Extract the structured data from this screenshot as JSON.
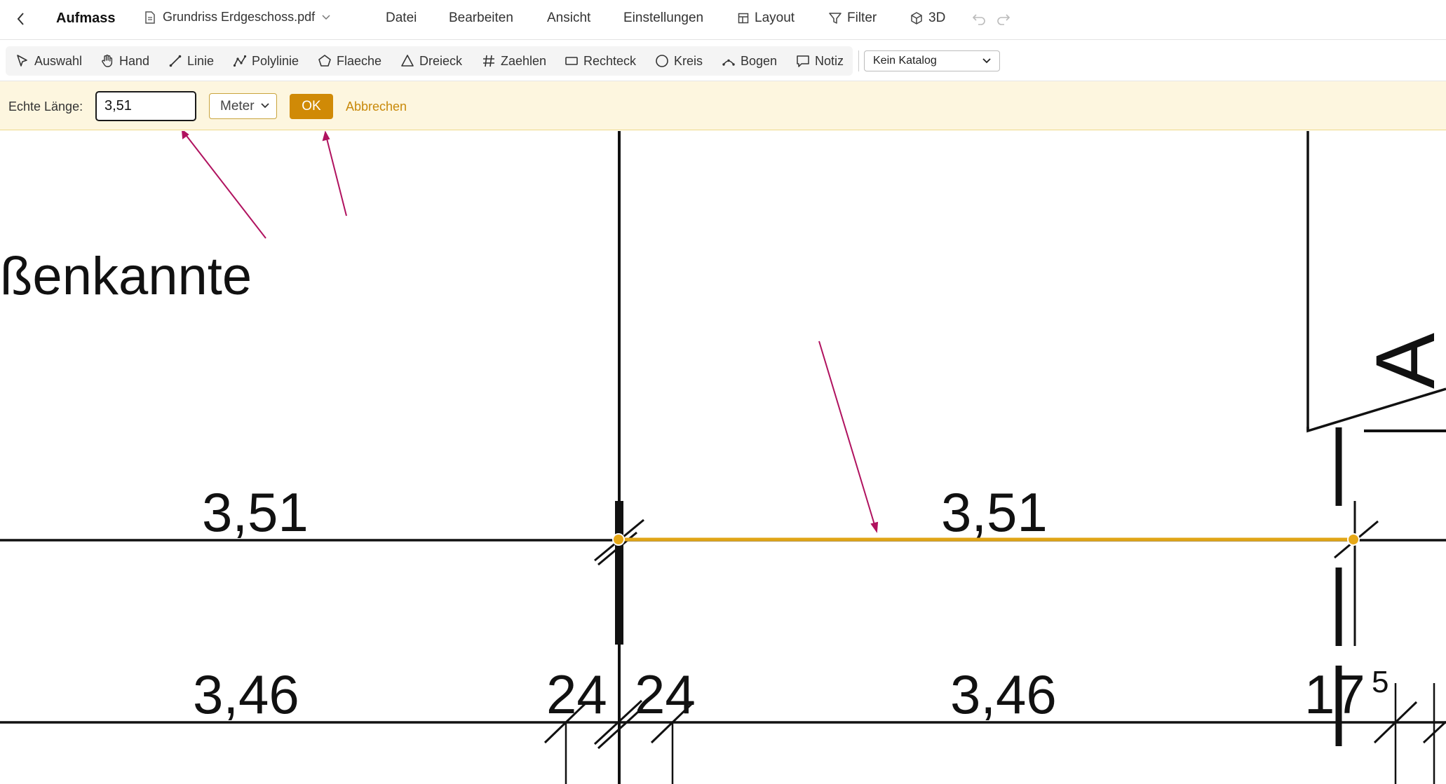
{
  "header": {
    "title": "Aufmass",
    "file_name": "Grundriss Erdgeschoss.pdf",
    "menu": [
      "Datei",
      "Bearbeiten",
      "Ansicht",
      "Einstellungen"
    ],
    "layout_label": "Layout",
    "filter_label": "Filter",
    "view3d_label": "3D"
  },
  "tools": [
    {
      "label": "Auswahl",
      "icon": "cursor-icon"
    },
    {
      "label": "Hand",
      "icon": "hand-icon"
    },
    {
      "label": "Linie",
      "icon": "line-icon"
    },
    {
      "label": "Polylinie",
      "icon": "polyline-icon"
    },
    {
      "label": "Flaeche",
      "icon": "pentagon-icon"
    },
    {
      "label": "Dreieck",
      "icon": "triangle-icon"
    },
    {
      "label": "Zaehlen",
      "icon": "hash-icon"
    },
    {
      "label": "Rechteck",
      "icon": "rectangle-icon"
    },
    {
      "label": "Kreis",
      "icon": "circle-icon"
    },
    {
      "label": "Bogen",
      "icon": "arc-icon"
    },
    {
      "label": "Notiz",
      "icon": "comment-icon"
    }
  ],
  "catalog": {
    "selected": "Kein Katalog"
  },
  "calibration": {
    "label": "Echte Länge:",
    "value": "3,51",
    "unit": "Meter",
    "ok_label": "OK",
    "cancel_label": "Abbrechen"
  },
  "drawing": {
    "heading_fragment": "ßenkannte",
    "dim_upper_left": "3,51",
    "dim_upper_right": "3,51",
    "dim_lower_left": "3,46",
    "dim_lower_mid_a": "24",
    "dim_lower_mid_b": "24",
    "dim_lower_right": "3,46",
    "dim_lower_far": "17",
    "dim_lower_far_sup": "5",
    "door_letter": "A"
  },
  "colors": {
    "accent": "#d08a06",
    "calibration_bar": "#fdf6df",
    "measure_line": "#e0a516",
    "annotation_arrow": "#b0125f"
  }
}
